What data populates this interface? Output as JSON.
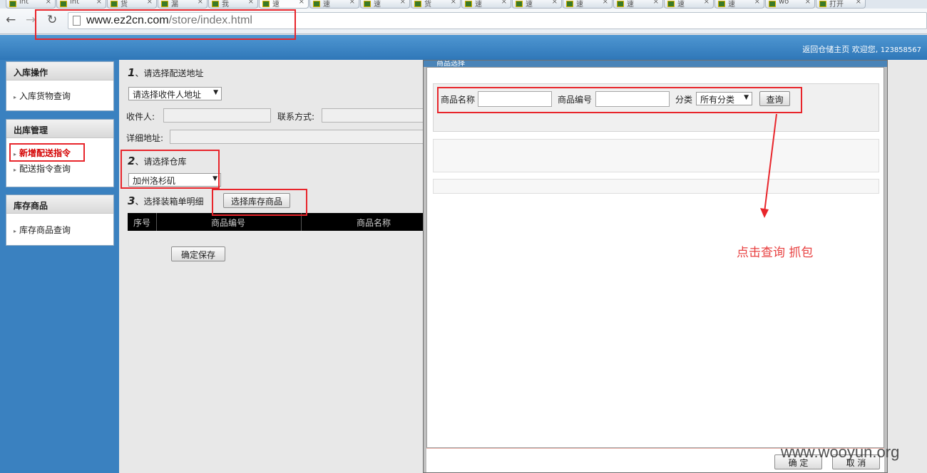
{
  "browser": {
    "tabs": [
      {
        "label": "int"
      },
      {
        "label": "int"
      },
      {
        "label": "货"
      },
      {
        "label": "漏"
      },
      {
        "label": "我"
      },
      {
        "label": "速",
        "active": true
      },
      {
        "label": "速"
      },
      {
        "label": "速"
      },
      {
        "label": "货"
      },
      {
        "label": "速"
      },
      {
        "label": "速"
      },
      {
        "label": "速"
      },
      {
        "label": "速"
      },
      {
        "label": "速"
      },
      {
        "label": "速"
      },
      {
        "label": "wo"
      },
      {
        "label": "打开"
      }
    ],
    "url_host": "www.ez2cn.com",
    "url_path": "/store/index.html"
  },
  "header": {
    "home_link": "返回仓储主页",
    "welcome": "欢迎您,",
    "username": "123858567"
  },
  "sidebar": {
    "sections": [
      {
        "title": "入库操作",
        "items": [
          {
            "label": "入库货物查询"
          }
        ]
      },
      {
        "title": "出库管理",
        "items": [
          {
            "label": "新增配送指令",
            "highlight": true
          },
          {
            "label": "配送指令查询"
          }
        ]
      },
      {
        "title": "库存商品",
        "items": [
          {
            "label": "库存商品查询"
          }
        ]
      }
    ]
  },
  "form": {
    "step1": {
      "num": "1",
      "label": "、请选择配送地址"
    },
    "address_select": "请选择收件人地址",
    "recipient_label": "收件人:",
    "contact_label": "联系方式:",
    "detail_label": "详细地址:",
    "step2": {
      "num": "2",
      "label": "、请选择仓库"
    },
    "warehouse_select": "加州洛杉矶",
    "step3": {
      "num": "3",
      "label": "、选择装箱单明细"
    },
    "choose_button": "选择库存商品",
    "table_headers": [
      "序号",
      "商品编号",
      "商品名称"
    ],
    "save_button": "确定保存"
  },
  "modal": {
    "title": "商品选择",
    "name_label": "商品名称",
    "code_label": "商品编号",
    "category_label": "分类",
    "category_value": "所有分类",
    "query_button": "查询",
    "ok_button": "确  定",
    "cancel_button": "取  消"
  },
  "annotations": {
    "note": "点击查询 抓包",
    "color": "#e8252b"
  },
  "watermark": "www.wooyun.org"
}
